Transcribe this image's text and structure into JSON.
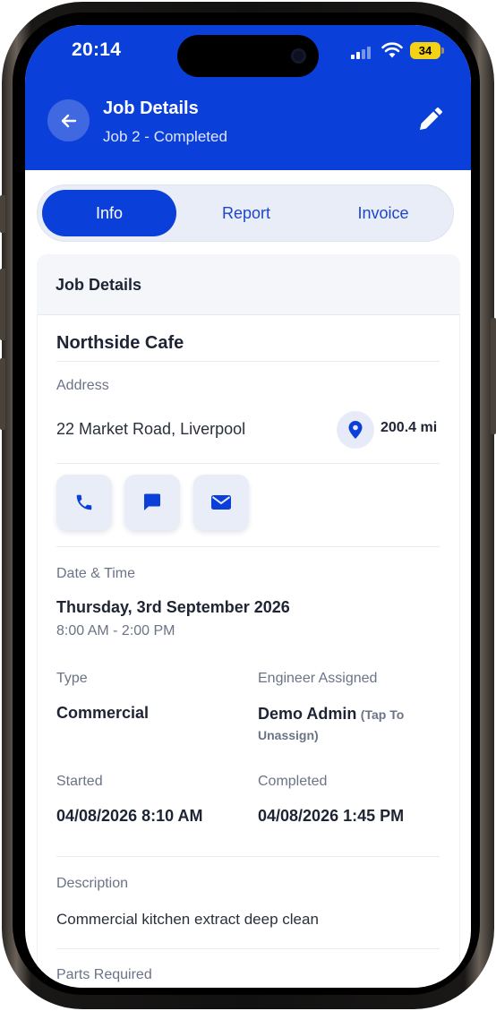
{
  "status_bar": {
    "time": "20:14",
    "battery": "34"
  },
  "header": {
    "title": "Job Details",
    "subtitle": "Job 2 - Completed"
  },
  "tabs": [
    {
      "label": "Info",
      "active": true
    },
    {
      "label": "Report"
    },
    {
      "label": "Invoice"
    }
  ],
  "section_title": "Job Details",
  "job": {
    "customer": "Northside Cafe",
    "address_label": "Address",
    "address": "22 Market Road, Liverpool",
    "distance": "200.4 mi",
    "datetime_label": "Date & Time",
    "date": "Thursday, 3rd September 2026",
    "time_range": "8:00 AM - 2:00 PM",
    "type_label": "Type",
    "type": "Commercial",
    "engineer_label": "Engineer Assigned",
    "engineer": "Demo Admin",
    "engineer_note": "(Tap To Unassign)",
    "started_label": "Started",
    "started": "04/08/2026 8:10 AM",
    "completed_label": "Completed",
    "completed": "04/08/2026 1:45 PM",
    "description_label": "Description",
    "description": "Commercial kitchen extract deep clean",
    "parts_label": "Parts Required"
  },
  "colors": {
    "primary": "#0b3fd9",
    "accent_bg": "#e8edf8"
  }
}
